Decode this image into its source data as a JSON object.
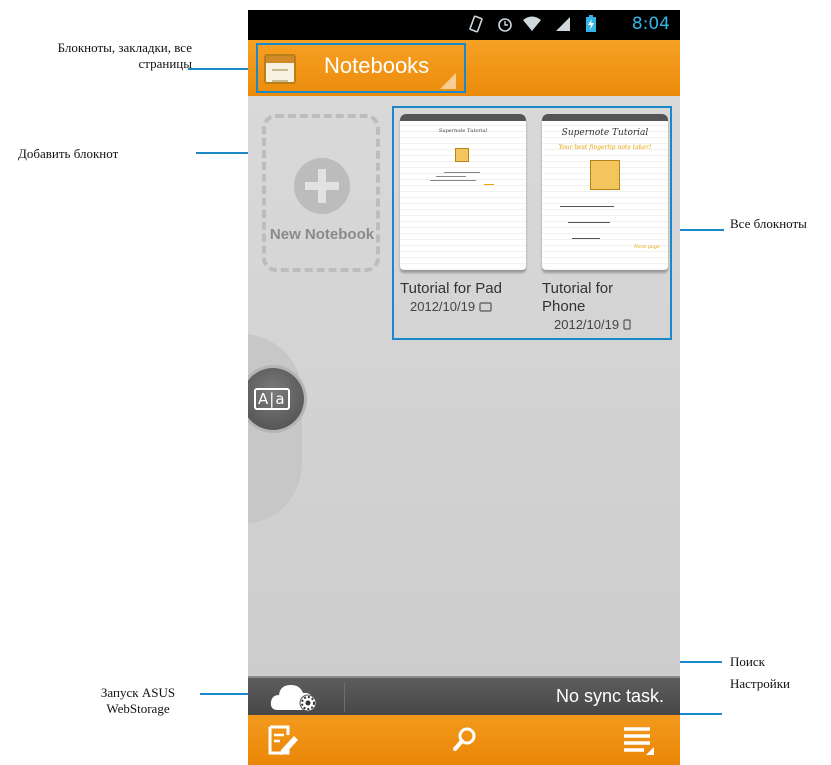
{
  "annotations": {
    "notebooks_menu": "Блокноты, закладки, все страницы",
    "add_notebook": "Добавить блокнот",
    "all_notebooks": "Все блокноты",
    "webstorage": "Запуск ASUS WebStorage",
    "search": "Поиск",
    "settings": "Настройки"
  },
  "status_bar": {
    "time": "8:04",
    "icons": [
      "vibrate-icon",
      "alarm-icon",
      "wifi-icon",
      "signal-icon",
      "battery-charging-icon"
    ]
  },
  "action_bar": {
    "title": "Notebooks",
    "icon": "notebook-icon"
  },
  "new_notebook": {
    "label": "New Notebook",
    "icon": "plus-icon"
  },
  "notebooks": [
    {
      "name": "Tutorial for Pad",
      "date": "2012/10/19",
      "device_icon": "tablet-icon",
      "cover_title": "Supernote Tutorial"
    },
    {
      "name": "Tutorial for Phone",
      "date": "2012/10/19",
      "device_icon": "phone-icon",
      "cover_title": "Supernote Tutorial",
      "cover_subtitle": "Your best fingertip note taker!",
      "cover_footer": "Next page"
    }
  ],
  "side_tab": {
    "icon": "dictionary-icon",
    "label": "A|a"
  },
  "sync_bar": {
    "status": "No sync task.",
    "icon": "cloud-settings-icon"
  },
  "bottom_bar": {
    "icons": [
      "new-note-icon",
      "search-icon",
      "menu-icon"
    ]
  },
  "colors": {
    "accent_orange": "#ec8b0b",
    "callout_blue": "#1a88c9",
    "status_blue": "#33b5e5"
  }
}
